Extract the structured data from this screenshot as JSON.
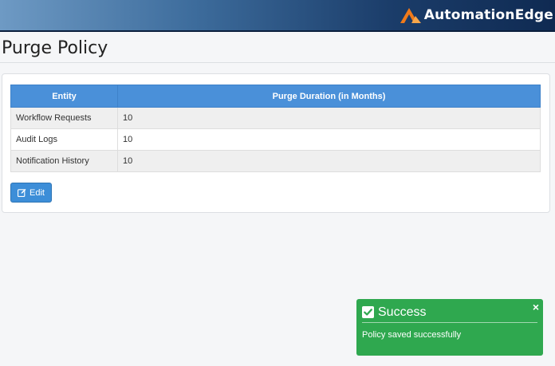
{
  "brand": {
    "name": "AutomationEdge"
  },
  "page": {
    "title": "Purge Policy"
  },
  "table": {
    "headers": [
      "Entity",
      "Purge Duration (in Months)"
    ],
    "rows": [
      {
        "entity": "Workflow Requests",
        "duration": "10"
      },
      {
        "entity": "Audit Logs",
        "duration": "10"
      },
      {
        "entity": "Notification History",
        "duration": "10"
      }
    ]
  },
  "actions": {
    "edit_label": "Edit"
  },
  "toast": {
    "title": "Success",
    "message": "Policy saved successfully",
    "close_glyph": "×"
  },
  "colors": {
    "header_blue": "#4a90d9",
    "button_blue": "#3d8ed8",
    "toast_green": "#2fa84f",
    "brand_orange": "#f07a1a"
  },
  "icons": {
    "brand": "automationedge-logo-icon",
    "edit": "edit-icon",
    "check": "check-square-icon",
    "close": "close-icon"
  }
}
